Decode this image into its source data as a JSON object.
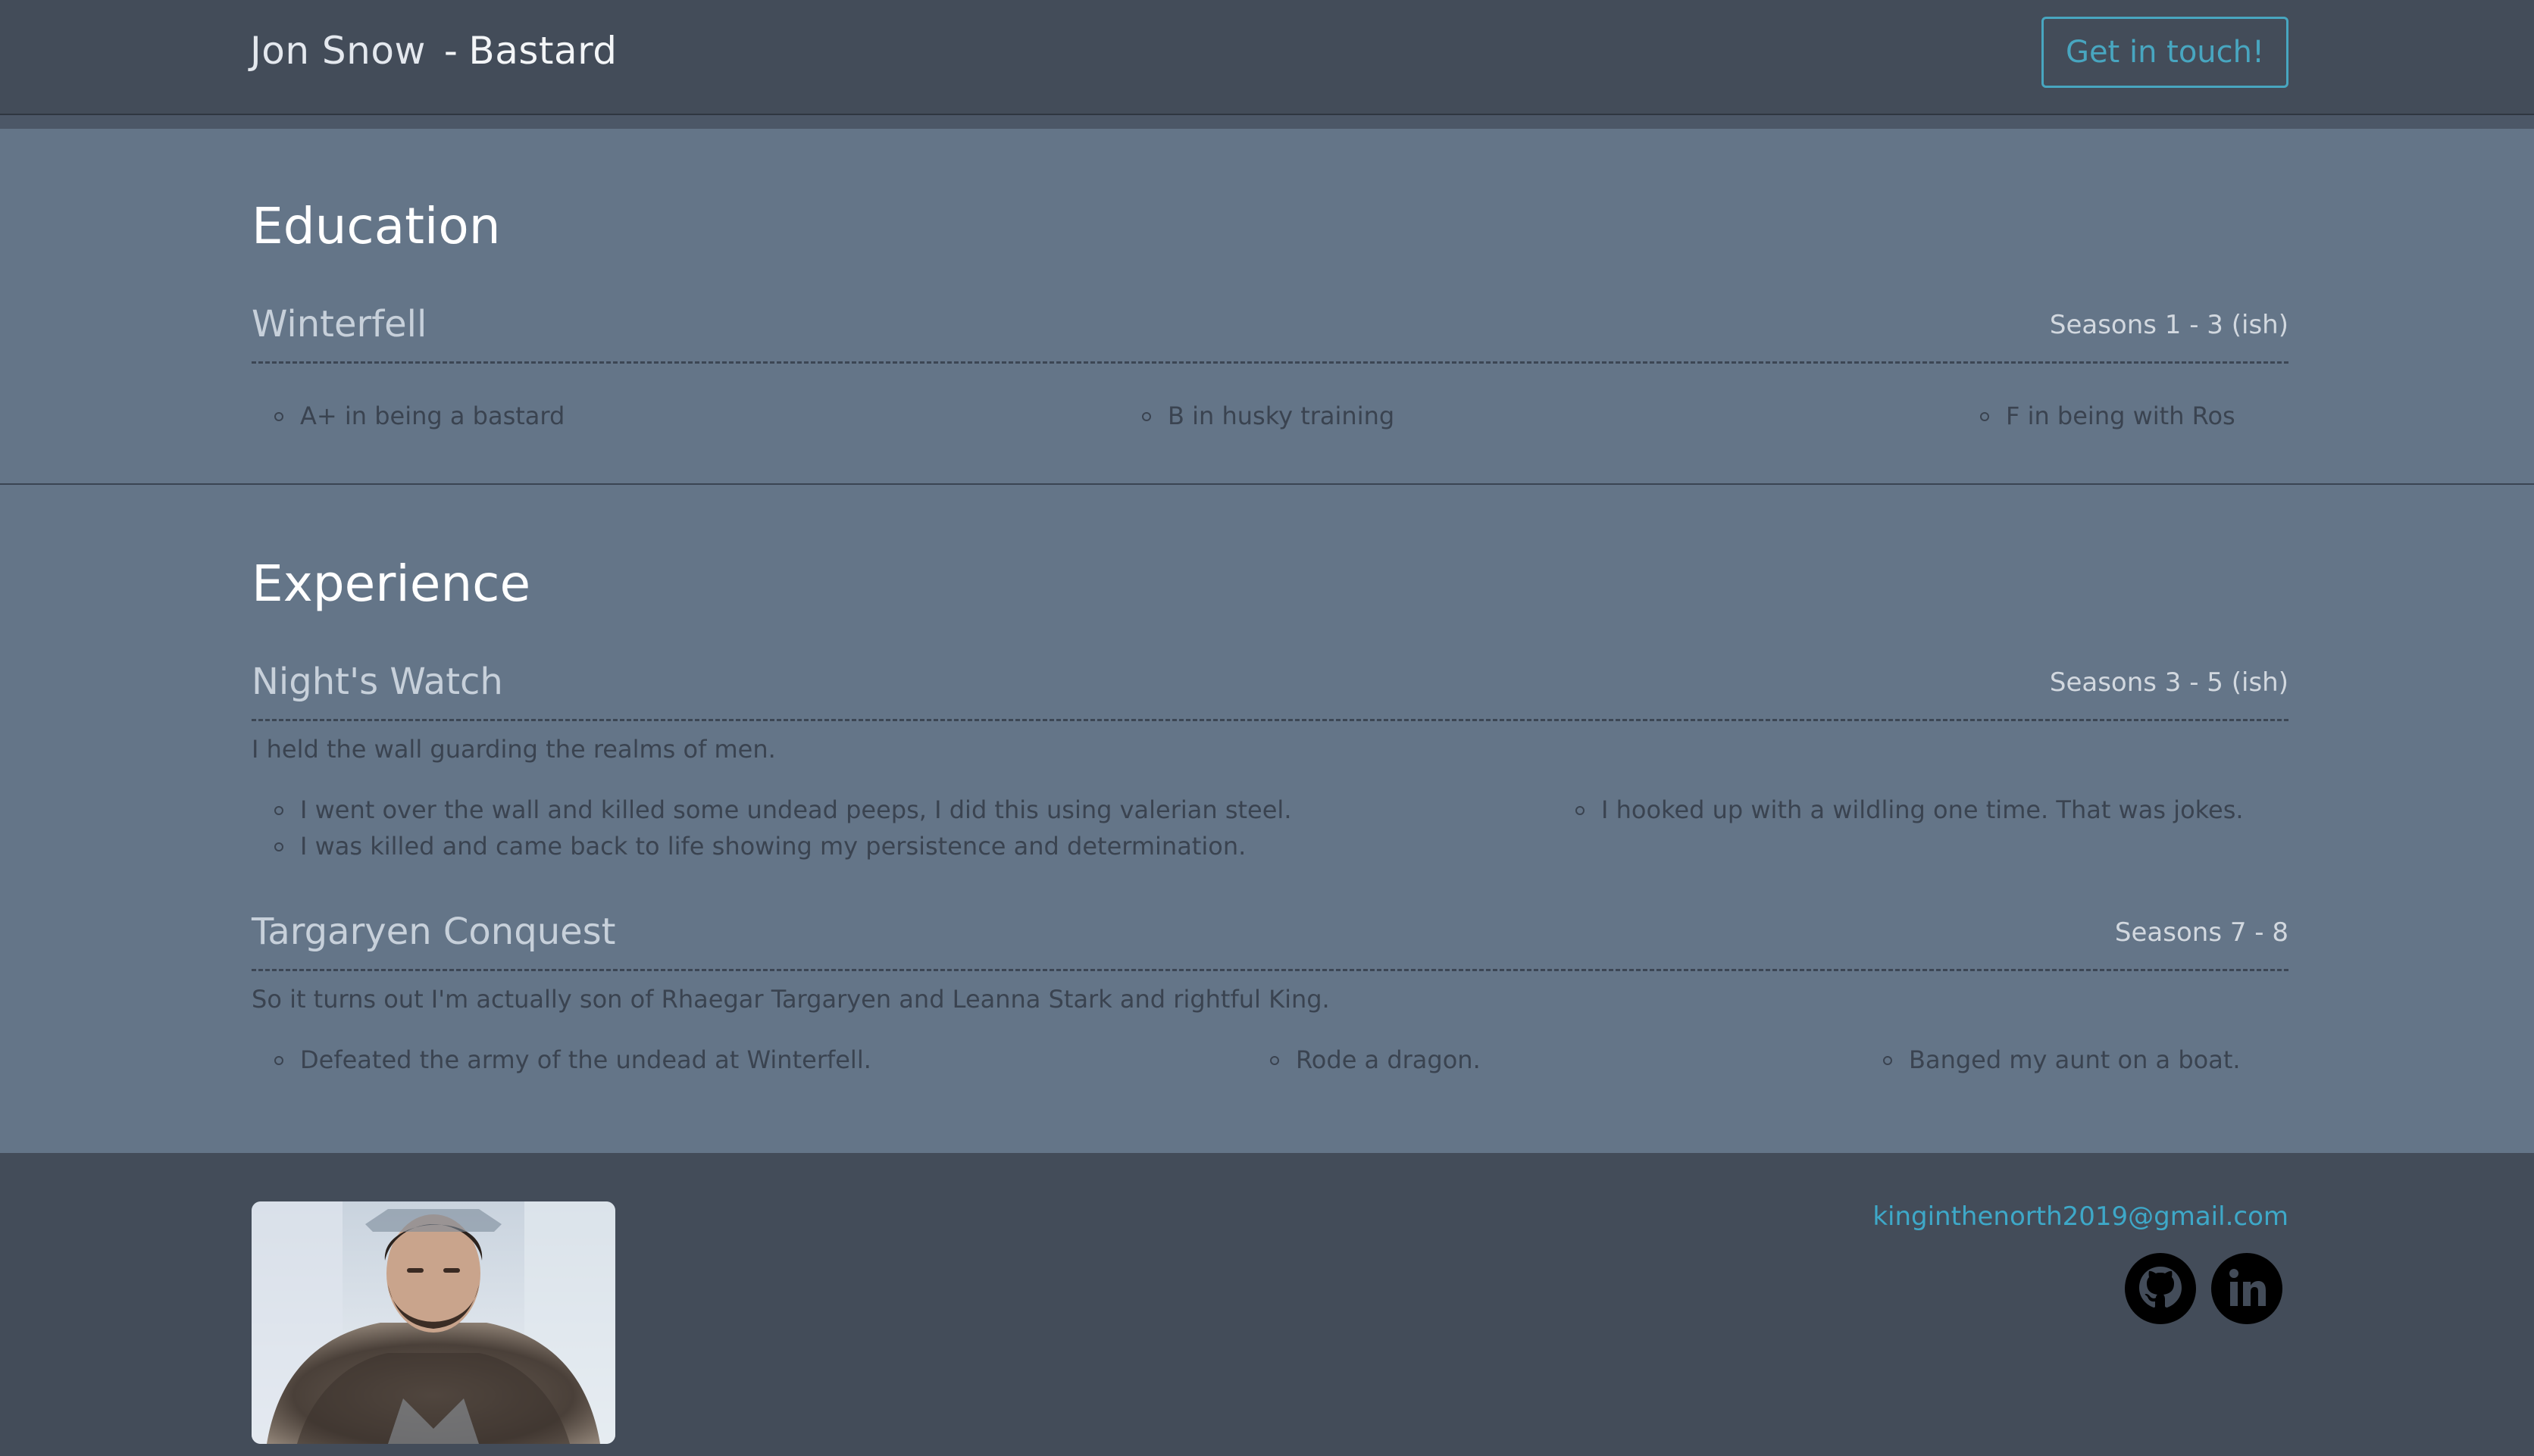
{
  "header": {
    "name": "Jon Snow",
    "separator": "-",
    "title": "Bastard",
    "cta_label": "Get in touch!"
  },
  "education": {
    "heading": "Education",
    "entries": [
      {
        "title": "Winterfell",
        "dates": "Seasons 1 - 3 (ish)",
        "items": [
          "A+ in being a bastard",
          "B in husky training",
          "F in being with Ros"
        ]
      }
    ]
  },
  "experience": {
    "heading": "Experience",
    "entries": [
      {
        "title": "Night's Watch",
        "dates": "Seasons 3 - 5 (ish)",
        "description": "I held the wall guarding the realms of men.",
        "items": [
          "I went over the wall and killed some undead peeps, I did this using valerian steel.",
          "I hooked up with a wildling one time. That was jokes.",
          "I was killed and came back to life showing my persistence and determination."
        ]
      },
      {
        "title": "Targaryen Conquest",
        "dates": "Seasons 7 - 8",
        "description": "So it turns out I'm actually son of Rhaegar Targaryen and Leanna Stark and rightful King.",
        "items": [
          "Defeated the army of the undead at Winterfell.",
          "Rode a dragon.",
          "Banged my aunt on a boat."
        ]
      }
    ]
  },
  "footer": {
    "email": "kinginthenorth2019@gmail.com",
    "social": [
      "github-icon",
      "linkedin-icon"
    ]
  },
  "colors": {
    "header_bg": "#434c59",
    "main_bg": "#647588",
    "accent": "#48a6c0",
    "link": "#3ea8c8"
  }
}
